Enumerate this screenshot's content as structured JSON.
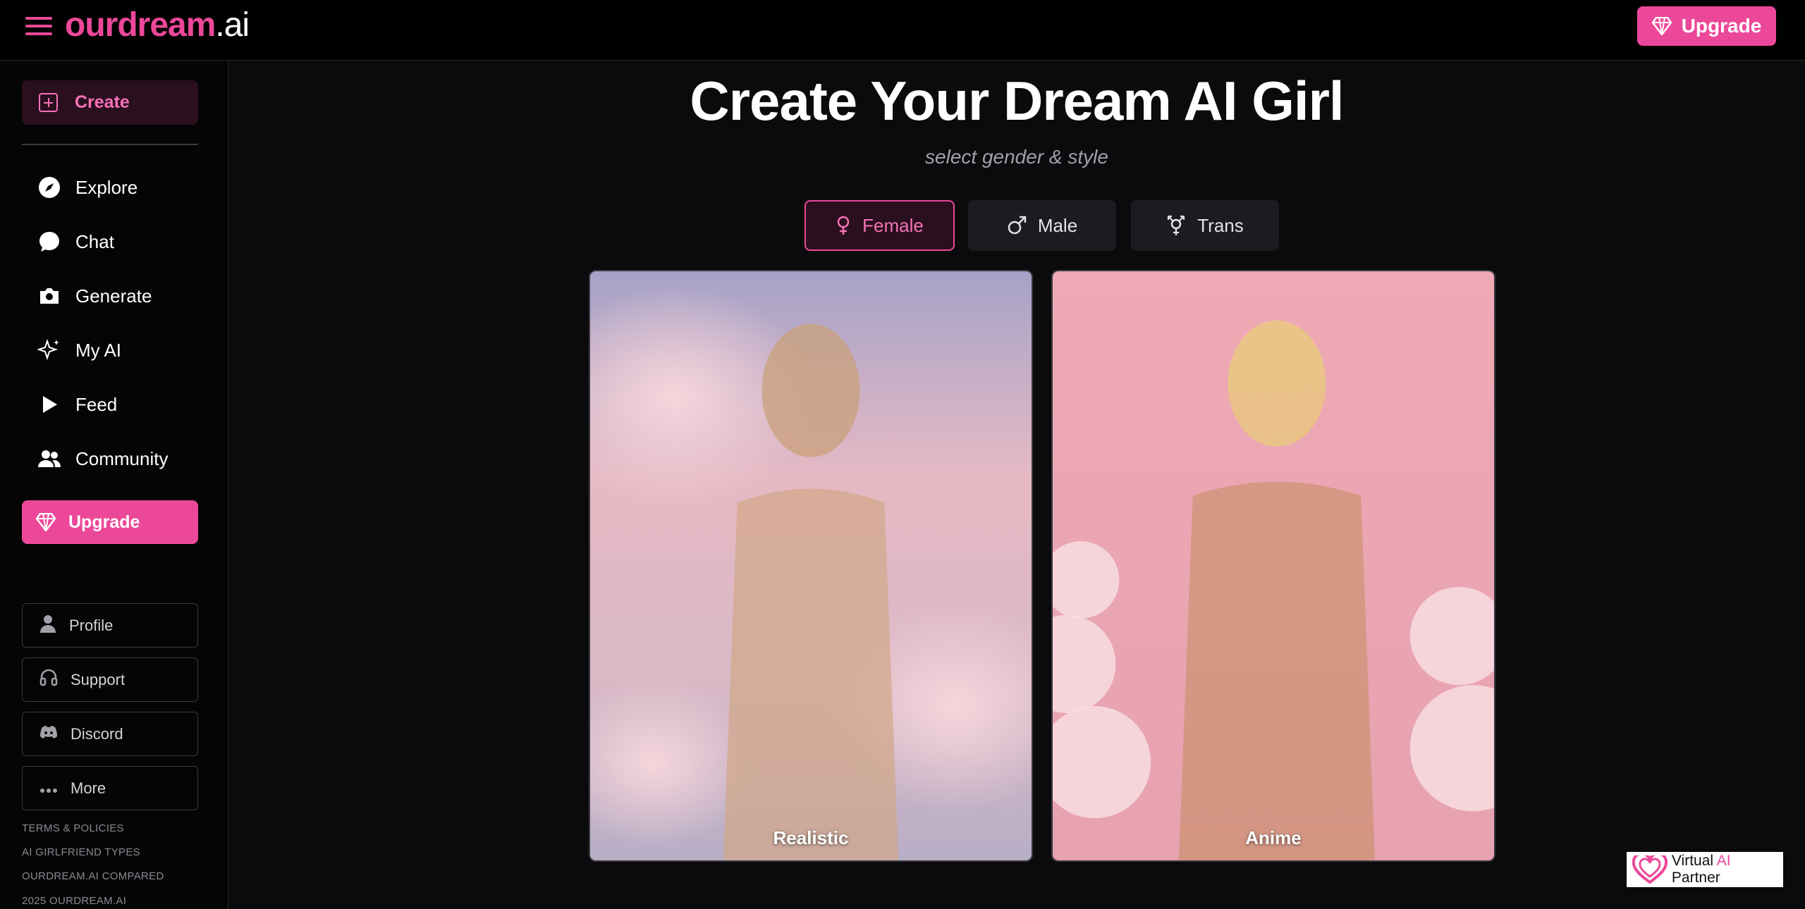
{
  "header": {
    "logo_brand": "ourdream",
    "logo_tld": ".ai",
    "upgrade_label": "Upgrade"
  },
  "sidebar": {
    "create_label": "Create",
    "nav_items": [
      {
        "label": "Explore",
        "icon": "compass-icon"
      },
      {
        "label": "Chat",
        "icon": "chat-bubble-icon"
      },
      {
        "label": "Generate",
        "icon": "camera-icon"
      },
      {
        "label": "My AI",
        "icon": "sparkles-icon"
      },
      {
        "label": "Feed",
        "icon": "play-icon"
      },
      {
        "label": "Community",
        "icon": "users-icon"
      }
    ],
    "upgrade_label": "Upgrade",
    "box_items": [
      {
        "label": "Profile",
        "icon": "user-icon"
      },
      {
        "label": "Support",
        "icon": "headset-icon"
      },
      {
        "label": "Discord",
        "icon": "discord-icon"
      },
      {
        "label": "More",
        "icon": "more-dots-icon"
      }
    ],
    "footer_links": [
      "TERMS & POLICIES",
      "AI GIRLFRIEND TYPES",
      "OURDREAM.AI COMPARED",
      "2025 OURDREAM.AI"
    ]
  },
  "main": {
    "title": "Create Your Dream AI Girl",
    "subtitle": "select gender & style",
    "genders": [
      {
        "label": "Female",
        "icon": "female-icon",
        "selected": true
      },
      {
        "label": "Male",
        "icon": "male-icon",
        "selected": false
      },
      {
        "label": "Trans",
        "icon": "transgender-icon",
        "selected": false
      }
    ],
    "styles": [
      {
        "label": "Realistic"
      },
      {
        "label": "Anime"
      }
    ]
  },
  "partner_badge": {
    "text_prefix": "Virtual ",
    "text_ai": "AI",
    "text_suffix": " Partner"
  },
  "colors": {
    "accent": "#ec4899",
    "background": "#0b0b0d",
    "sidebar": "#050506"
  }
}
